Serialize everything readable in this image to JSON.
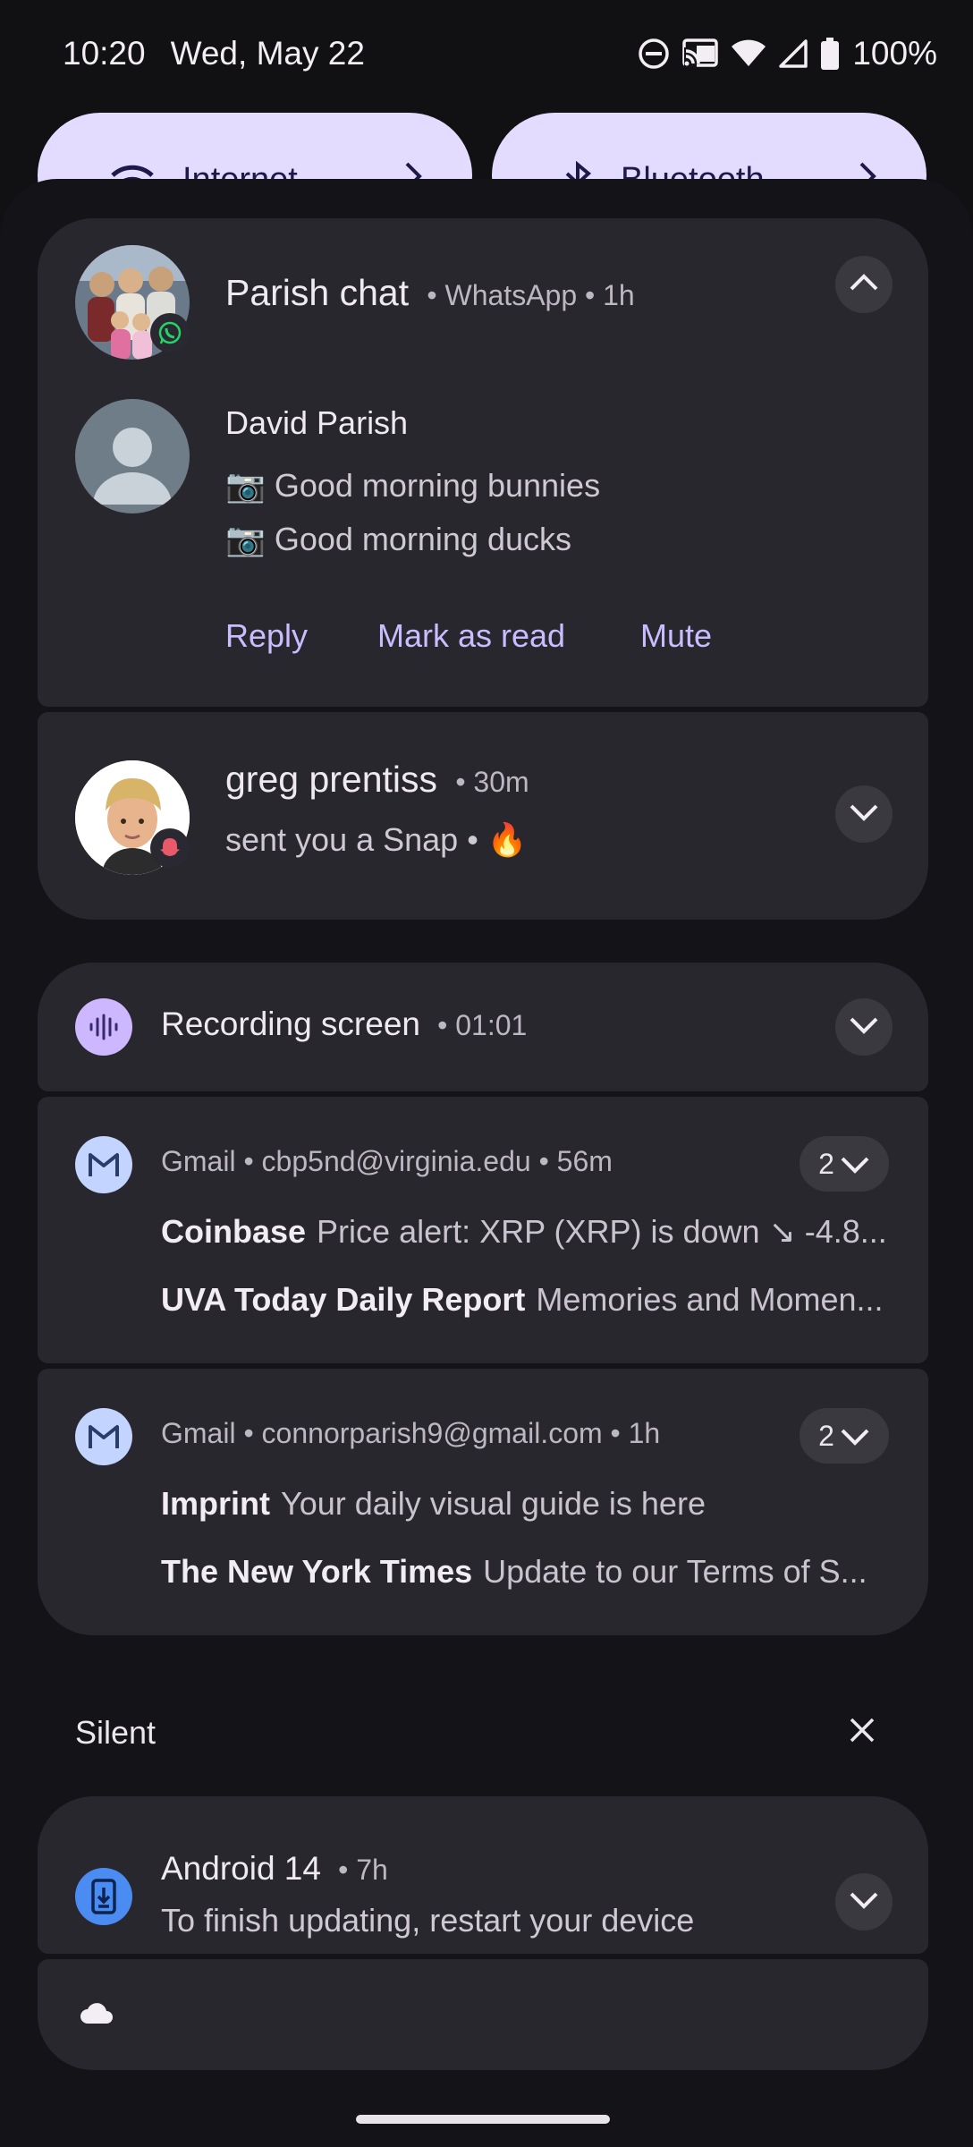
{
  "status_bar": {
    "time": "10:20",
    "date": "Wed, May 22",
    "battery": "100%",
    "icons": [
      "do-not-disturb-icon",
      "cast-icon",
      "wifi-icon",
      "signal-icon",
      "battery-icon"
    ]
  },
  "quick_settings": {
    "tiles": [
      {
        "label": "Internet",
        "icon": "wifi-icon"
      },
      {
        "label": "Bluetooth",
        "icon": "bluetooth-icon"
      }
    ]
  },
  "notifications": {
    "whatsapp": {
      "title": "Parish chat",
      "app": "WhatsApp",
      "time": "1h",
      "sender": "David Parish",
      "messages": [
        "📷 Good morning bunnies",
        "📷 Good morning ducks"
      ],
      "actions": [
        "Reply",
        "Mark as read",
        "Mute"
      ]
    },
    "snap": {
      "title": "greg prentiss",
      "time": "30m",
      "body": "sent you a Snap • 🔥"
    },
    "recording": {
      "title": "Recording screen",
      "time": "01:01"
    },
    "gmail_1": {
      "app": "Gmail",
      "account": "cbp5nd@virginia.edu",
      "time": "56m",
      "count": "2",
      "items": [
        {
          "sender": "Coinbase",
          "text": "Price alert: XRP (XRP) is down ↘ -4.8..."
        },
        {
          "sender": "UVA Today Daily Report",
          "text": "Memories and Momen..."
        }
      ]
    },
    "gmail_2": {
      "app": "Gmail",
      "account": "connorparish9@gmail.com",
      "time": "1h",
      "count": "2",
      "items": [
        {
          "sender": "Imprint",
          "text": "Your daily visual guide is here"
        },
        {
          "sender": "The New York Times",
          "text": "Update to our Terms of S..."
        }
      ]
    }
  },
  "silent_section": {
    "label": "Silent",
    "android": {
      "title": "Android 14",
      "time": "7h",
      "body": "To finish updating, restart your device"
    }
  },
  "colors": {
    "accent": "#c9bdff",
    "card": "#29272e",
    "background": "#141317",
    "tile": "#e3dcff"
  }
}
